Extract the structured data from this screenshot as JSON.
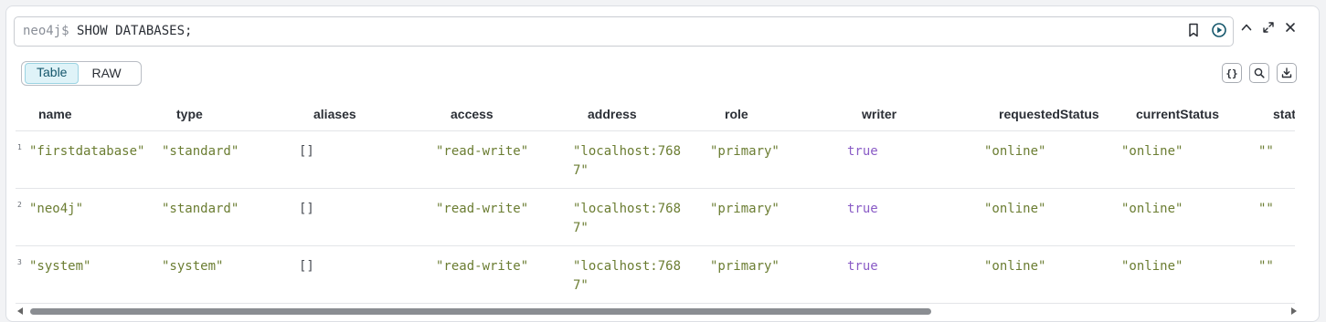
{
  "editor": {
    "prompt": "neo4j$",
    "query": "SHOW DATABASES;"
  },
  "view_toggle": {
    "options": [
      "Table",
      "RAW"
    ],
    "selected": "Table"
  },
  "actions": {
    "format_label": "{}"
  },
  "table": {
    "columns": [
      "name",
      "type",
      "aliases",
      "access",
      "address",
      "role",
      "writer",
      "requestedStatus",
      "currentStatus",
      "stat"
    ],
    "rows": [
      {
        "index": "1",
        "name": "\"firstdatabase\"",
        "type": "\"standard\"",
        "aliases": "[]",
        "access": "\"read-write\"",
        "address": "\"localhost:7687\"",
        "role": "\"primary\"",
        "writer": "true",
        "requestedStatus": "\"online\"",
        "currentStatus": "\"online\"",
        "stat": "\"\""
      },
      {
        "index": "2",
        "name": "\"neo4j\"",
        "type": "\"standard\"",
        "aliases": "[]",
        "access": "\"read-write\"",
        "address": "\"localhost:7687\"",
        "role": "\"primary\"",
        "writer": "true",
        "requestedStatus": "\"online\"",
        "currentStatus": "\"online\"",
        "stat": "\"\""
      },
      {
        "index": "3",
        "name": "\"system\"",
        "type": "\"system\"",
        "aliases": "[]",
        "access": "\"read-write\"",
        "address": "\"localhost:7687\"",
        "role": "\"primary\"",
        "writer": "true",
        "requestedStatus": "\"online\"",
        "currentStatus": "\"online\"",
        "stat": "\"\""
      }
    ]
  },
  "horizontal_scroll": {
    "visible_fraction": 0.72,
    "position": 0.0
  },
  "colors": {
    "accent": "#14566b",
    "string": "#6b7d32",
    "boolean": "#8a5cc6"
  }
}
